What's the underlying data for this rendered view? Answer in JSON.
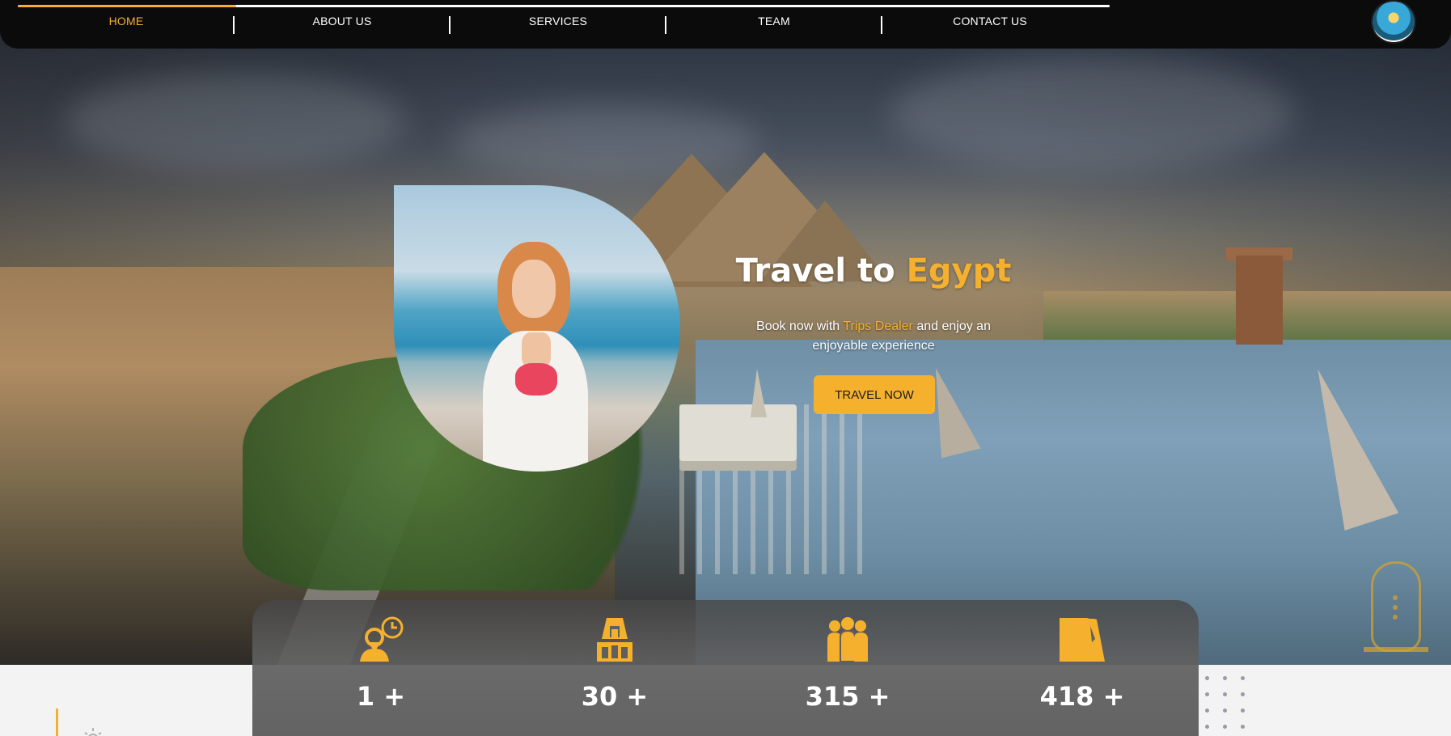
{
  "nav": {
    "items": [
      {
        "label": "HOME",
        "active": true
      },
      {
        "label": "ABOUT US",
        "active": false
      },
      {
        "label": "SERVICES",
        "active": false
      },
      {
        "label": "TEAM",
        "active": false
      },
      {
        "label": "CONTACT US",
        "active": false
      }
    ],
    "scroll_progress": 0.2,
    "logo_icon": "trips-dealer-logo-icon"
  },
  "hero": {
    "title_prefix": "Travel to",
    "title_highlight": "Egypt",
    "subtitle_before": "Book now with",
    "subtitle_brand": "Trips Dealer",
    "subtitle_after": "and enjoy an enjoyable experience",
    "cta_label": "TRAVEL NOW"
  },
  "stats": [
    {
      "icon": "location-clock-icon",
      "value": "1 +"
    },
    {
      "icon": "pharaoh-icon",
      "value": "30 +"
    },
    {
      "icon": "people-group-icon",
      "value": "315 +"
    },
    {
      "icon": "egypt-map-icon",
      "value": "418 +"
    }
  ],
  "colors": {
    "accent": "#f5b02e",
    "nav_bg": "#0b0b0b",
    "stats_bg": "#5f5f5f"
  }
}
